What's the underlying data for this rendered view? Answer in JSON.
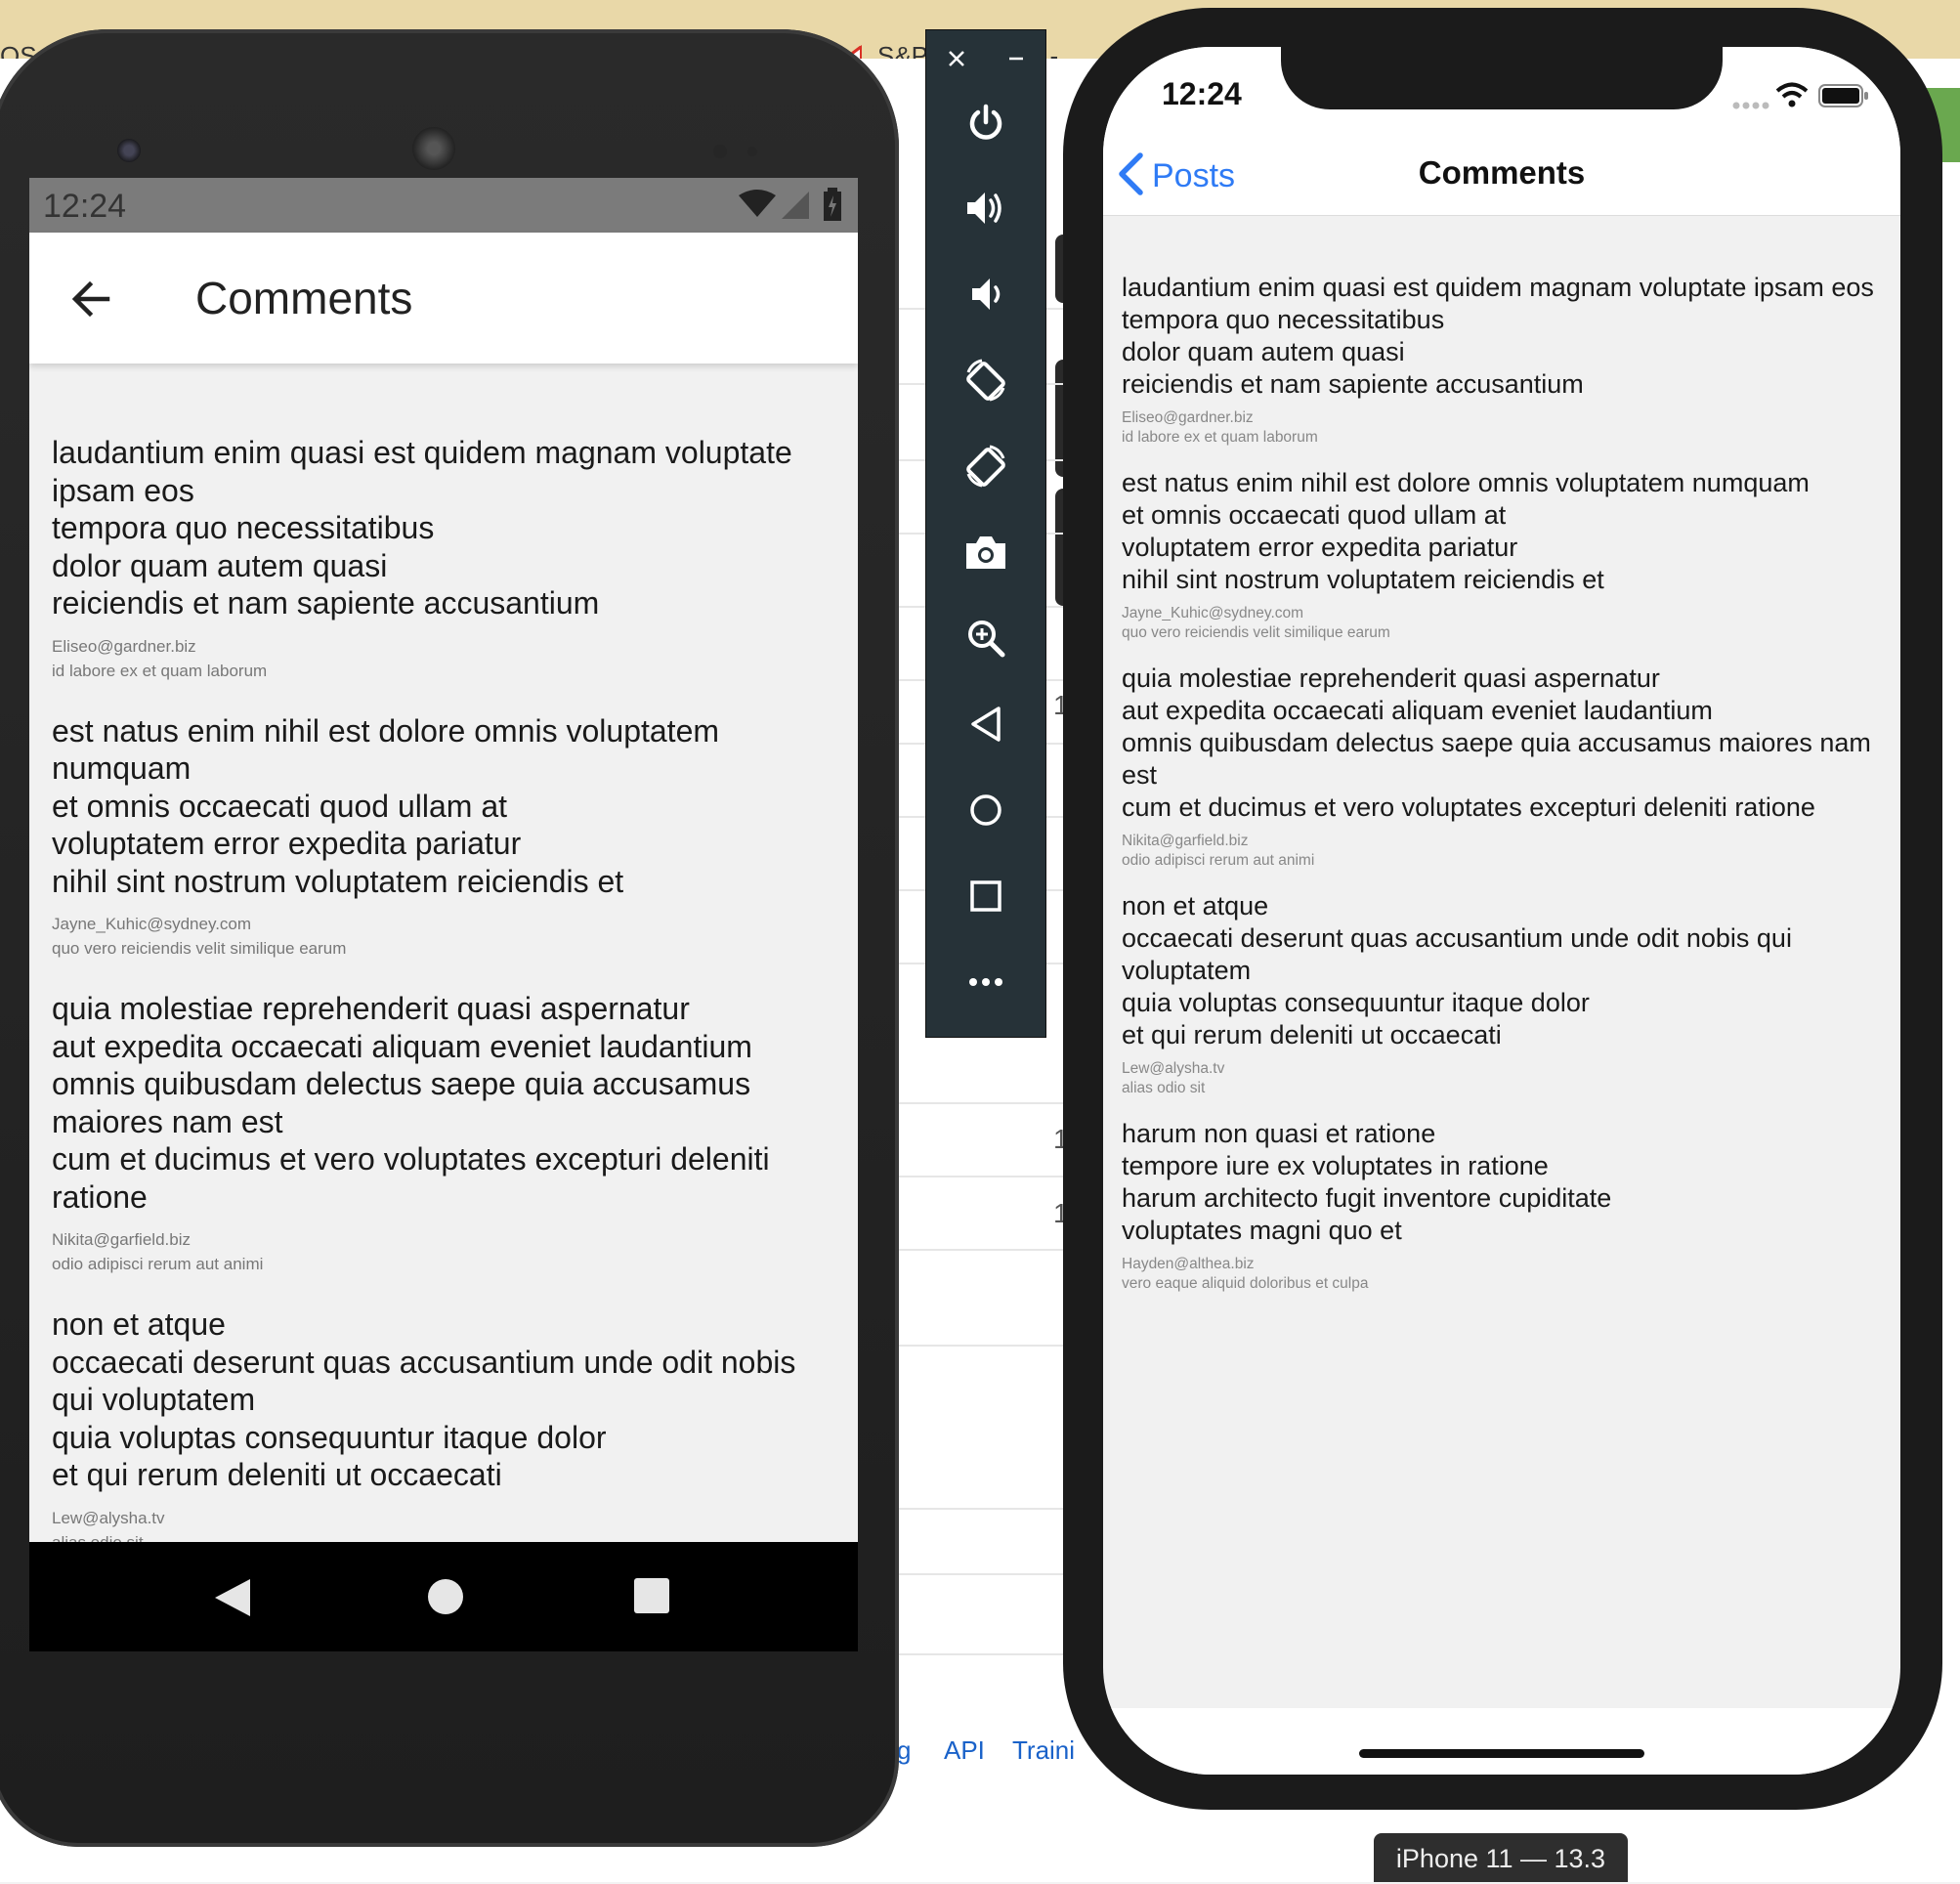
{
  "browser": {
    "tab_partial_left": "OS.nz",
    "tab_gmail": "S&P",
    "tab_partial_right": "t -",
    "footer_links": [
      "g",
      "API",
      "Traini"
    ],
    "bg_numbers": [
      "1",
      "1",
      "1"
    ]
  },
  "android": {
    "time": "12:24",
    "title": "Comments",
    "comments": [
      {
        "body": "laudantium enim quasi est quidem magnam voluptate ipsam eos\ntempora quo necessitatibus\ndolor quam autem quasi\nreiciendis et nam sapiente accusantium",
        "email": "Eliseo@gardner.biz",
        "name": "id labore ex et quam laborum"
      },
      {
        "body": "est natus enim nihil est dolore omnis voluptatem numquam\net omnis occaecati quod ullam at\nvoluptatem error expedita pariatur\nnihil sint nostrum voluptatem reiciendis et",
        "email": "Jayne_Kuhic@sydney.com",
        "name": "quo vero reiciendis velit similique earum"
      },
      {
        "body": "quia molestiae reprehenderit quasi aspernatur\naut expedita occaecati aliquam eveniet laudantium\nomnis quibusdam delectus saepe quia accusamus maiores nam est\ncum et ducimus et vero voluptates excepturi deleniti ratione",
        "email": "Nikita@garfield.biz",
        "name": "odio adipisci rerum aut animi"
      },
      {
        "body": "non et atque\noccaecati deserunt quas accusantium unde odit nobis qui voluptatem\nquia voluptas consequuntur itaque dolor\net qui rerum deleniti ut occaecati",
        "email": "Lew@alysha.tv",
        "name": "alias odio sit"
      }
    ]
  },
  "ios": {
    "time": "12:24",
    "back_label": "Posts",
    "title": "Comments",
    "device_label": "iPhone 11 — 13.3",
    "comments": [
      {
        "body": "laudantium enim quasi est quidem magnam voluptate ipsam eos\ntempora quo necessitatibus\ndolor quam autem quasi\nreiciendis et nam sapiente accusantium",
        "email": "Eliseo@gardner.biz",
        "name": "id labore ex et quam laborum"
      },
      {
        "body": "est natus enim nihil est dolore omnis voluptatem numquam\net omnis occaecati quod ullam at\nvoluptatem error expedita pariatur\nnihil sint nostrum voluptatem reiciendis et",
        "email": "Jayne_Kuhic@sydney.com",
        "name": "quo vero reiciendis velit similique earum"
      },
      {
        "body": "quia molestiae reprehenderit quasi aspernatur\naut expedita occaecati aliquam eveniet laudantium\nomnis quibusdam delectus saepe quia accusamus maiores nam est\ncum et ducimus et vero voluptates excepturi deleniti ratione",
        "email": "Nikita@garfield.biz",
        "name": "odio adipisci rerum aut animi"
      },
      {
        "body": "non et atque\noccaecati deserunt quas accusantium unde odit nobis qui voluptatem\nquia voluptas consequuntur itaque dolor\net qui rerum deleniti ut occaecati",
        "email": "Lew@alysha.tv",
        "name": "alias odio sit"
      },
      {
        "body": "harum non quasi et ratione\ntempore iure ex voluptates in ratione\nharum architecto fugit inventore cupiditate\nvoluptates magni quo et",
        "email": "Hayden@althea.biz",
        "name": "vero eaque aliquid doloribus et culpa"
      }
    ]
  },
  "toolbar": {
    "buttons": [
      "close-icon",
      "minimize-icon",
      "power-icon",
      "volume-up-icon",
      "volume-down-icon",
      "rotate-left-icon",
      "rotate-right-icon",
      "camera-icon",
      "zoom-icon",
      "back-icon",
      "home-icon",
      "overview-icon",
      "more-icon"
    ]
  },
  "colors": {
    "ios_accent": "#2f7bf5",
    "emulator_toolbar": "#263238",
    "android_statusbar": "#7b7b7b"
  }
}
